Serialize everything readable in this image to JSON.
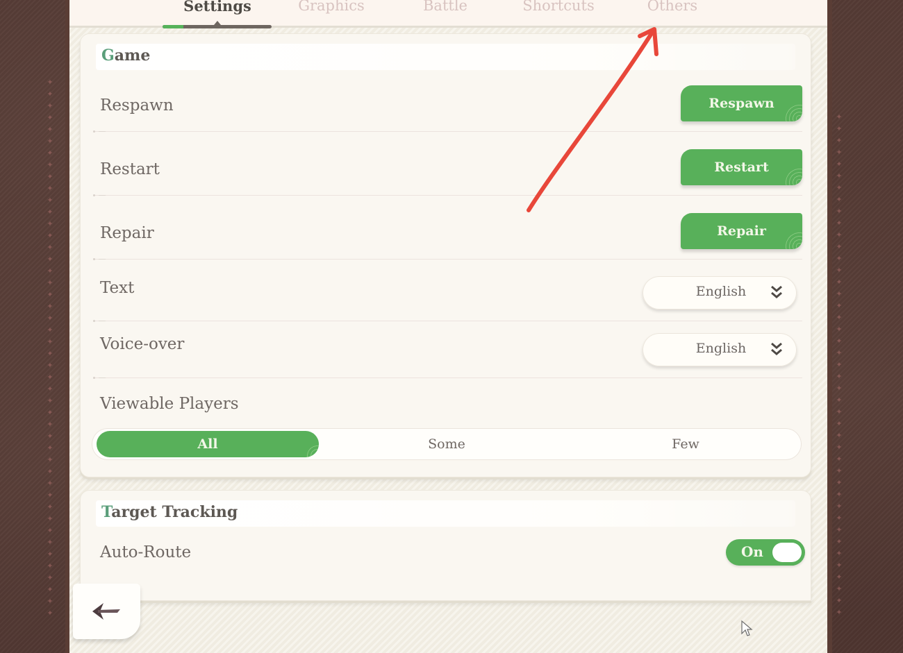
{
  "tabs": [
    {
      "label": "Settings",
      "active": true
    },
    {
      "label": "Graphics",
      "active": false
    },
    {
      "label": "Battle",
      "active": false
    },
    {
      "label": "Shortcuts",
      "active": false
    },
    {
      "label": "Others",
      "active": false
    }
  ],
  "game_section": {
    "title_first": "G",
    "title_rest": "ame",
    "rows": {
      "respawn": {
        "label": "Respawn",
        "button": "Respawn"
      },
      "restart": {
        "label": "Restart",
        "button": "Restart"
      },
      "repair": {
        "label": "Repair",
        "button": "Repair"
      },
      "text": {
        "label": "Text",
        "value": "English"
      },
      "voice_over": {
        "label": "Voice-over",
        "value": "English"
      },
      "viewable_players": {
        "label": "Viewable Players",
        "options": [
          "All",
          "Some",
          "Few"
        ],
        "selected": "All"
      }
    }
  },
  "tracking_section": {
    "title_first": "T",
    "title_rest": "arget Tracking",
    "auto_route": {
      "label": "Auto-Route",
      "state": "On"
    }
  },
  "colors": {
    "accent_green": "#58b05a",
    "annotation_red": "#e8473a",
    "frame_brown": "#5a3d35"
  },
  "icons": {
    "back": "back-arrow-icon",
    "dropdown": "double-chevron-down-icon",
    "annotation": "red-arrow-annotation",
    "cursor": "mouse-pointer-icon"
  }
}
